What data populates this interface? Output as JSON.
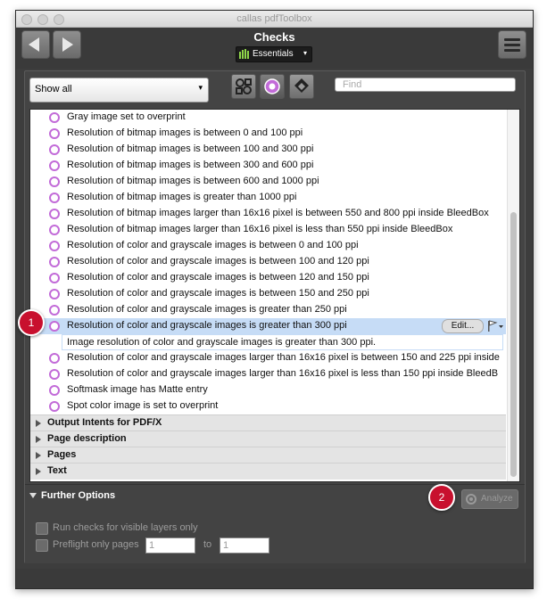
{
  "window": {
    "title": "callas pdfToolbox"
  },
  "header": {
    "title": "Checks",
    "profile_label": "Essentials"
  },
  "filter": {
    "selected": "Show all",
    "search_placeholder": "Find"
  },
  "checks": [
    "Gray image set to overprint",
    "Resolution of bitmap images is between 0 and 100 ppi",
    "Resolution of bitmap images is between 100 and 300 ppi",
    "Resolution of bitmap images is between 300 and 600 ppi",
    "Resolution of bitmap images is between 600 and 1000 ppi",
    "Resolution of bitmap images is greater than 1000 ppi",
    "Resolution of bitmap images larger than 16x16 pixel is between 550 and 800 ppi inside BleedBox",
    "Resolution of bitmap images larger than 16x16 pixel is less than 550 ppi inside BleedBox",
    "Resolution of color and grayscale images is between 0 and 100 ppi",
    "Resolution of color and grayscale images is between 100 and 120 ppi",
    "Resolution of color and grayscale images is between 120 and 150 ppi",
    "Resolution of color and grayscale images is between 150 and 250 ppi",
    "Resolution of color and grayscale images is greater than 250 ppi",
    "Resolution of color and grayscale images is greater than 300 ppi",
    "Resolution of color and grayscale images larger than 16x16 pixel is between 150 and 225 ppi inside",
    "Resolution of color and grayscale images larger than 16x16 pixel is less than 150 ppi inside BleedB",
    "Softmask image has Matte entry",
    "Spot color image is set to overprint"
  ],
  "selected": {
    "edit_label": "Edit...",
    "description": "Image resolution of color and grayscale images is greater than 300 ppi."
  },
  "categories": [
    "Output Intents for PDF/X",
    "Page description",
    "Pages",
    "Text"
  ],
  "further_options": {
    "label": "Further Options",
    "analyze_label": "Analyze",
    "visible_layers_label": "Run checks for visible layers only",
    "preflight_pages_label": "Preflight only pages",
    "from_page": "1",
    "to_label": "to",
    "to_page": "1"
  },
  "badges": [
    "1",
    "2"
  ],
  "colors": {
    "accent": "#c26bd8",
    "selection": "#c6dcf6",
    "badge": "#c8102e",
    "window_bg": "#3d3d3d"
  }
}
